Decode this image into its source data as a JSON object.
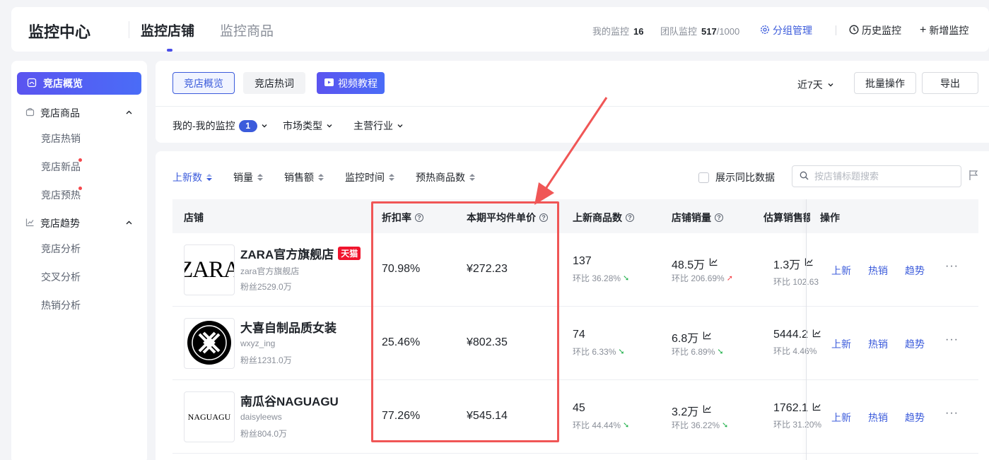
{
  "header": {
    "app_title": "监控中心",
    "tabs": [
      {
        "label": "监控店铺",
        "active": true
      },
      {
        "label": "监控商品",
        "active": false
      }
    ],
    "my_monitor_label": "我的监控",
    "my_monitor_value": "16",
    "team_monitor_label": "团队监控",
    "team_monitor_value": "517",
    "team_monitor_total": "/1000",
    "group_manage": "分组管理",
    "history_monitor": "历史监控",
    "add_monitor": "新增监控"
  },
  "sidebar": {
    "active_item": "竞店概览",
    "groups": [
      {
        "label": "竞店商品",
        "items": [
          "竞店热销",
          "竞店新品",
          "竞店预热"
        ]
      },
      {
        "label": "竞店趋势",
        "items": [
          "竞店分析",
          "交叉分析",
          "热销分析"
        ]
      }
    ]
  },
  "toolbar": {
    "tab_overview": "竞店概览",
    "tab_keywords": "竞店热词",
    "video_tutorial": "视频教程",
    "date_range": "近7天",
    "batch_ops": "批量操作",
    "export": "导出"
  },
  "filters": {
    "my_monitor": "我的-我的监控",
    "my_monitor_count": "1",
    "market_type": "市场类型",
    "main_industry": "主营行业"
  },
  "sort_options": [
    "上新数",
    "销量",
    "销售额",
    "监控时间",
    "预热商品数"
  ],
  "show_yoy": "展示同比数据",
  "search": {
    "placeholder": "按店铺标题搜索"
  },
  "table": {
    "columns": {
      "shop": "店铺",
      "discount": "折扣率",
      "avg_price": "本期平均件单价",
      "new_items": "上新商品数",
      "shop_sales": "店铺销量",
      "est_sales": "估算销售额",
      "actions": "操作"
    },
    "actions": [
      "上新",
      "热销",
      "趋势"
    ],
    "more": "···",
    "rows": [
      {
        "name": "ZARA官方旗舰店",
        "badge": "天猫",
        "id": "zara官方旗舰店",
        "fans": "粉丝2529.0万",
        "logo_text": "ZARA",
        "discount": "70.98%",
        "avg_price": "¥272.23",
        "new_items": "137",
        "new_items_change": "环比 36.28%",
        "new_items_dir": "down",
        "shop_sales": "48.5万",
        "shop_sales_change": "环比 206.69%",
        "shop_sales_dir": "up",
        "est_sales": "1.3万",
        "est_sales_change": "环比 102.63"
      },
      {
        "name": "大喜自制品质女装",
        "badge": "",
        "id": "wxyz_ing",
        "fans": "粉丝1231.0万",
        "logo_text": "",
        "discount": "25.46%",
        "avg_price": "¥802.35",
        "new_items": "74",
        "new_items_change": "环比 6.33%",
        "new_items_dir": "down",
        "shop_sales": "6.8万",
        "shop_sales_change": "环比 6.89%",
        "shop_sales_dir": "down",
        "est_sales": "5444.2",
        "est_sales_change": "环比 4.46%"
      },
      {
        "name": "南瓜谷NAGUAGU",
        "badge": "",
        "id": "daisyleews",
        "fans": "粉丝804.0万",
        "logo_text": "NAGUAGU",
        "discount": "77.26%",
        "avg_price": "¥545.14",
        "new_items": "45",
        "new_items_change": "环比 44.44%",
        "new_items_dir": "down",
        "shop_sales": "3.2万",
        "shop_sales_change": "环比 36.22%",
        "shop_sales_dir": "down",
        "est_sales": "1762.1",
        "est_sales_change": "环比 31.20%"
      }
    ]
  },
  "colors": {
    "accent": "#3b5bdb",
    "highlight": "#f05656",
    "tmall": "#f0142d"
  }
}
